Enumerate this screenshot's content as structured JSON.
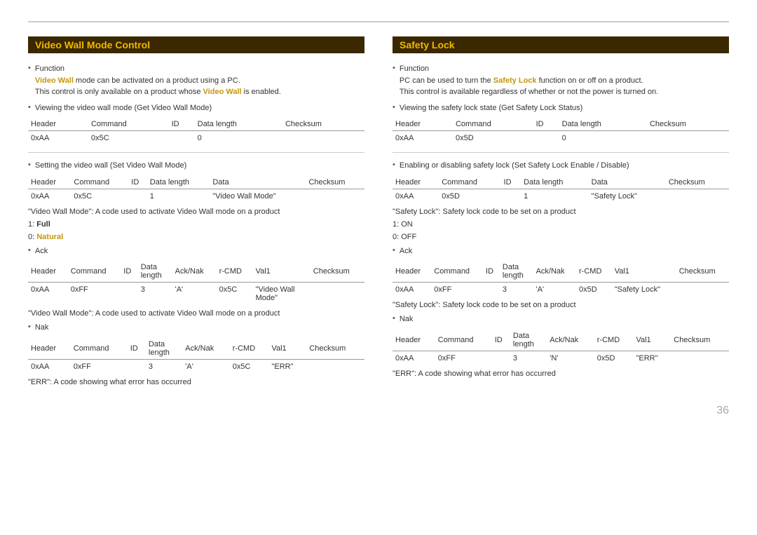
{
  "page": {
    "number": "36",
    "top_border": true
  },
  "left_section": {
    "title": "Video Wall Mode Control",
    "function_label": "Function",
    "function_text1": "Video Wall mode can be activated on a product using a PC.",
    "function_text1_gold": "Video Wall",
    "function_text2_pre": "This control is only available on a product whose ",
    "function_text2_gold": "Video Wall",
    "function_text2_post": " is enabled.",
    "get_title": "Viewing the video wall mode (Get Video Wall Mode)",
    "get_table_headers": [
      "Header",
      "Command",
      "ID",
      "Data length",
      "Checksum"
    ],
    "get_table_row": [
      "0xAA",
      "0x5C",
      "",
      "0",
      ""
    ],
    "set_title": "Setting the video wall (Set Video Wall Mode)",
    "set_table_headers": [
      "Header",
      "Command",
      "ID",
      "Data length",
      "Data",
      "Checksum"
    ],
    "set_table_row": [
      "0xAA",
      "0x5C",
      "",
      "1",
      "\"Video Wall Mode\"",
      ""
    ],
    "note1": "\"Video Wall Mode\": A code used to activate Video Wall mode on a product",
    "value1_label": "1: ",
    "value1": "Full",
    "value2_label": "0: ",
    "value2": "Natural",
    "ack_title": "Ack",
    "ack_table_headers": [
      "Header",
      "Command",
      "ID",
      "Data length",
      "Ack/Nak",
      "r-CMD",
      "Val1",
      "Checksum"
    ],
    "ack_table_row": [
      "0xAA",
      "0xFF",
      "",
      "3",
      "'A'",
      "0x5C",
      "\"Video Wall Mode\"",
      ""
    ],
    "note2": "\"Video Wall Mode\": A code used to activate Video Wall mode on a product",
    "nak_title": "Nak",
    "nak_table_headers": [
      "Header",
      "Command",
      "ID",
      "Data length",
      "Ack/Nak",
      "r-CMD",
      "Val1",
      "Checksum"
    ],
    "nak_table_row": [
      "0xAA",
      "0xFF",
      "",
      "3",
      "'A'",
      "0x5C",
      "\"ERR\"",
      ""
    ],
    "err_note": "\"ERR\": A code showing what error has occurred"
  },
  "right_section": {
    "title": "Safety Lock",
    "function_label": "Function",
    "function_text1_pre": "PC can be used to turn the ",
    "function_text1_gold": "Safety Lock",
    "function_text1_post": " function on or off on a product.",
    "function_text2": "This control is available regardless of whether or not the power is turned on.",
    "get_title": "Viewing the safety lock state (Get Safety Lock Status)",
    "get_table_headers": [
      "Header",
      "Command",
      "ID",
      "Data length",
      "Checksum"
    ],
    "get_table_row": [
      "0xAA",
      "0x5D",
      "",
      "0",
      ""
    ],
    "set_title": "Enabling or disabling safety lock (Set Safety Lock Enable / Disable)",
    "set_table_headers": [
      "Header",
      "Command",
      "ID",
      "Data length",
      "Data",
      "Checksum"
    ],
    "set_table_row": [
      "0xAA",
      "0x5D",
      "",
      "1",
      "\"Safety Lock\"",
      ""
    ],
    "note1": "\"Safety Lock\": Safety lock code to be set on a product",
    "value1_label": "1: ",
    "value1": "ON",
    "value2_label": "0: ",
    "value2": "OFF",
    "ack_title": "Ack",
    "ack_table_headers": [
      "Header",
      "Command",
      "ID",
      "Data length",
      "Ack/Nak",
      "r-CMD",
      "Val1",
      "Checksum"
    ],
    "ack_table_row": [
      "0xAA",
      "0xFF",
      "",
      "3",
      "'A'",
      "0x5D",
      "\"Safety Lock\"",
      ""
    ],
    "note2": "\"Safety Lock\": Safety lock code to be set on a product",
    "nak_title": "Nak",
    "nak_table_headers": [
      "Header",
      "Command",
      "ID",
      "Data length",
      "Ack/Nak",
      "r-CMD",
      "Val1",
      "Checksum"
    ],
    "nak_table_row": [
      "0xAA",
      "0xFF",
      "",
      "3",
      "'N'",
      "0x5D",
      "\"ERR\"",
      ""
    ],
    "err_note": "\"ERR\": A code showing what error has occurred"
  }
}
